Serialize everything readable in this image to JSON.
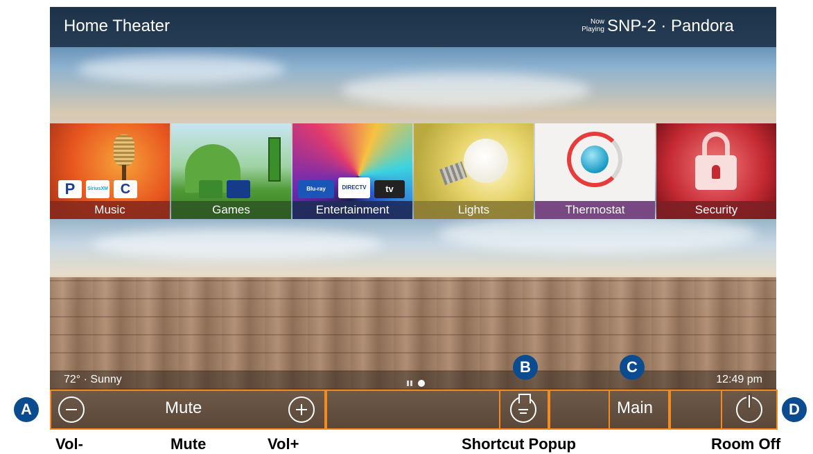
{
  "header": {
    "room": "Home Theater",
    "now_playing_label": "Now Playing",
    "source": "SNP-2 · Pandora"
  },
  "tiles": [
    {
      "label": "Music",
      "color": "#8a2a1c",
      "icons": [
        "P",
        "SiriusXM",
        "C"
      ]
    },
    {
      "label": "Games",
      "color": "#2f5a24",
      "icons": [
        "xbox",
        "playstation"
      ]
    },
    {
      "label": "Entertainment",
      "color": "#1f2d5a",
      "icons": [
        "Blu-ray",
        "DIRECTV",
        "tv"
      ]
    },
    {
      "label": "Lights",
      "color": "#8b7d35"
    },
    {
      "label": "Thermostat",
      "color": "#6b3a78"
    },
    {
      "label": "Security",
      "color": "#7d1f24"
    }
  ],
  "status": {
    "weather": "72° · Sunny",
    "time": "12:49 pm"
  },
  "controls": {
    "vol_down": "Vol-",
    "mute": "Mute",
    "vol_up": "Vol+",
    "main": "Main"
  },
  "markers": {
    "a": "A",
    "b": "B",
    "c": "C",
    "d": "D"
  },
  "captions": {
    "vol_down": "Vol-",
    "mute": "Mute",
    "vol_up": "Vol+",
    "shortcut": "Shortcut Popup",
    "room_off": "Room Off"
  },
  "colors": {
    "accent_orange": "#f38b1f",
    "marker_blue": "#0a4c8f"
  }
}
